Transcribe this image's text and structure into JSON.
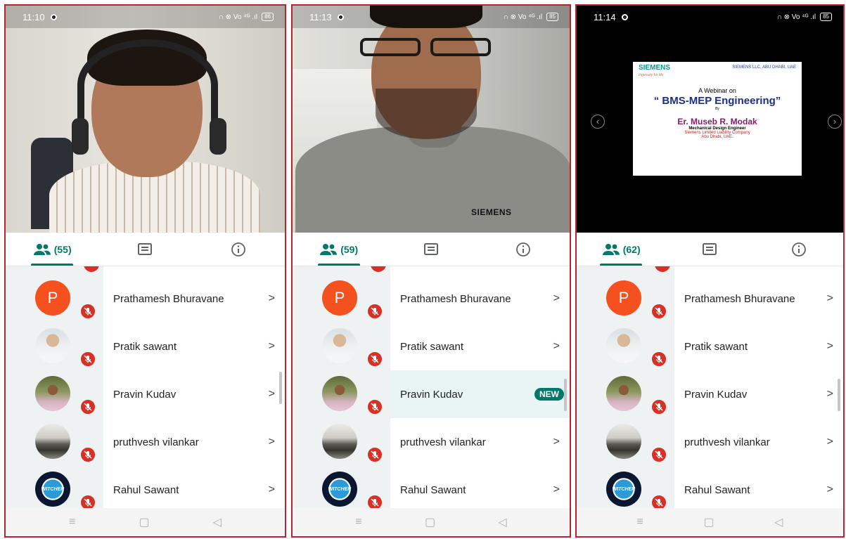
{
  "colors": {
    "frame_border": "#b5242f",
    "accent": "#00796b",
    "mute_badge": "#d93025",
    "letter_avatar": "#f4511e"
  },
  "panels": [
    {
      "status_time": "11:10",
      "status_icons": "∩ ⊗ Vo ⁴ᴳ .ıl",
      "battery": "86",
      "video_type": "camera",
      "participant_count": "(55)",
      "highlighted_row": -1,
      "rows": [
        {
          "avatar": "letter",
          "initial": "P",
          "name": "Prathamesh Bhuravane",
          "chevron": ">"
        },
        {
          "avatar": "photo1",
          "name": "Pratik sawant",
          "chevron": ">"
        },
        {
          "avatar": "photo2",
          "name": "Pravin Kudav",
          "chevron": ">"
        },
        {
          "avatar": "photo3",
          "name": "pruthvesh vilankar",
          "chevron": ">"
        },
        {
          "avatar": "photo4",
          "badge_text": "WITCHER",
          "name": "Rahul Sawant",
          "chevron": ">"
        }
      ]
    },
    {
      "status_time": "11:13",
      "status_icons": "∩ ⊗ Vo ⁴ᴳ .ıl",
      "battery": "85",
      "video_type": "camera",
      "shirt_logo": "SIEMENS",
      "participant_count": "(59)",
      "highlighted_row": 2,
      "new_label": "NEW",
      "rows": [
        {
          "avatar": "letter",
          "initial": "P",
          "name": "Prathamesh Bhuravane",
          "chevron": ">"
        },
        {
          "avatar": "photo1",
          "name": "Pratik sawant",
          "chevron": ">"
        },
        {
          "avatar": "photo2",
          "name": "Pravin Kudav",
          "chevron": ""
        },
        {
          "avatar": "photo3",
          "name": "pruthvesh vilankar",
          "chevron": ">"
        },
        {
          "avatar": "photo4",
          "badge_text": "WITCHER",
          "name": "Rahul Sawant",
          "chevron": ">"
        }
      ]
    },
    {
      "status_time": "11:14",
      "status_icons": "∩ ⊗ Vo ⁴ᴳ .ıl",
      "battery": "85",
      "video_type": "slide",
      "slide": {
        "logo": "SIEMENS",
        "tagline": "Ingenuity for life",
        "company": "SIEMENS LLC, ABU DHABI, UAE",
        "line1": "A Webinar on",
        "line2": "“ BMS-MEP Engineering”",
        "line3": "By",
        "line4": "Er. Museb R. Modak",
        "line5": "Mechanical Design Engineer",
        "line6": "Siemens Limited Liability Company",
        "line7": "Abu Dhabi, UAE."
      },
      "prev_arrow": "‹",
      "next_arrow": "›",
      "participant_count": "(62)",
      "highlighted_row": -1,
      "rows": [
        {
          "avatar": "letter",
          "initial": "P",
          "name": "Prathamesh Bhuravane",
          "chevron": ">"
        },
        {
          "avatar": "photo1",
          "name": "Pratik sawant",
          "chevron": ">"
        },
        {
          "avatar": "photo2",
          "name": "Pravin Kudav",
          "chevron": ">"
        },
        {
          "avatar": "photo3",
          "name": "pruthvesh vilankar",
          "chevron": ">"
        },
        {
          "avatar": "photo4",
          "badge_text": "WITCHER",
          "name": "Rahul Sawant",
          "chevron": ">"
        }
      ]
    }
  ],
  "icons": {
    "people": "people-icon",
    "chat": "chat-icon",
    "info": "info-icon",
    "mic_off": "mic-off-icon",
    "nav_menu": "≡",
    "nav_home": "▢",
    "nav_back": "◁"
  }
}
